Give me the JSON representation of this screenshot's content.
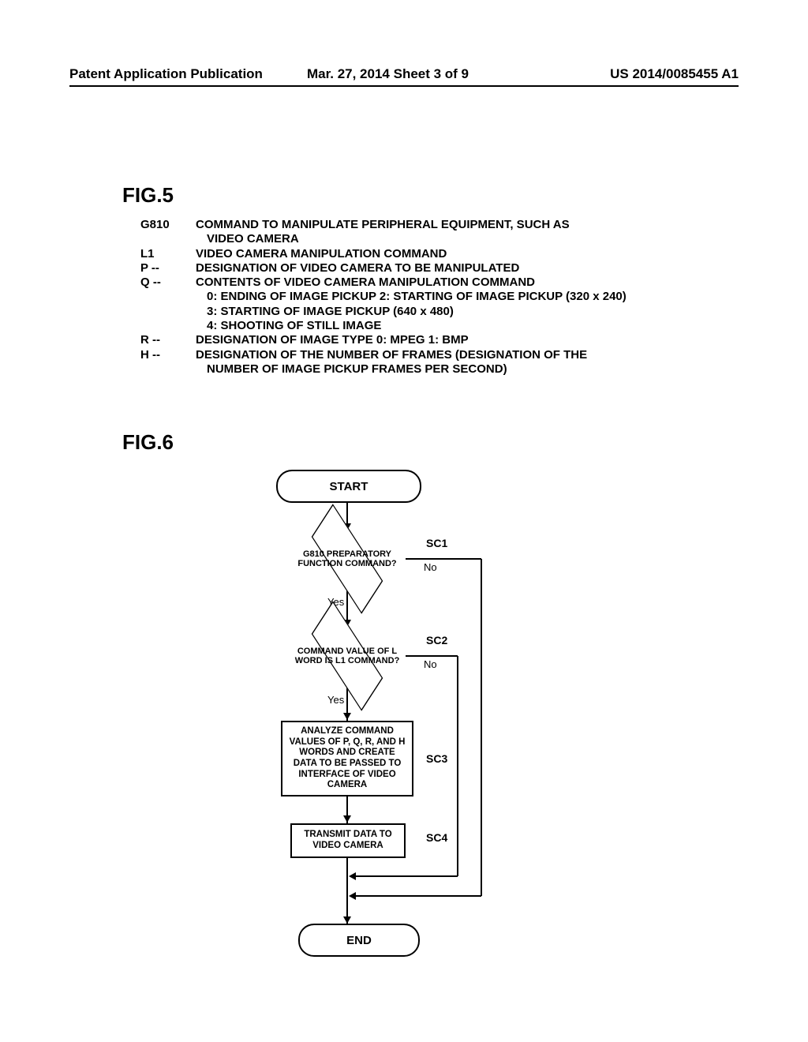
{
  "header": {
    "left": "Patent Application Publication",
    "mid": "Mar. 27, 2014  Sheet 3 of 9",
    "right": "US 2014/0085455 A1"
  },
  "fig5": {
    "label": "FIG.5",
    "rows": [
      {
        "code": "G810",
        "lines": [
          "COMMAND TO MANIPULATE PERIPHERAL EQUIPMENT, SUCH AS",
          "VIDEO CAMERA"
        ]
      },
      {
        "code": "L1",
        "lines": [
          "VIDEO CAMERA MANIPULATION COMMAND"
        ]
      },
      {
        "code": "P --",
        "lines": [
          "DESIGNATION OF VIDEO CAMERA TO BE MANIPULATED"
        ]
      },
      {
        "code": "Q --",
        "lines": [
          "CONTENTS OF VIDEO CAMERA MANIPULATION COMMAND",
          "0: ENDING OF IMAGE PICKUP  2: STARTING OF IMAGE PICKUP (320 x 240)",
          "3: STARTING OF IMAGE PICKUP (640 x 480)",
          "4: SHOOTING OF STILL IMAGE"
        ]
      },
      {
        "code": "R --",
        "lines": [
          "DESIGNATION OF IMAGE TYPE  0: MPEG  1: BMP"
        ]
      },
      {
        "code": "H --",
        "lines": [
          "DESIGNATION OF THE NUMBER OF FRAMES (DESIGNATION OF THE",
          "NUMBER OF IMAGE PICKUP FRAMES PER SECOND)"
        ]
      }
    ]
  },
  "fig6": {
    "label": "FIG.6",
    "start": "START",
    "end": "END",
    "d1": "G810 PREPARATORY FUNCTION COMMAND?",
    "d2": "COMMAND VALUE OF L WORD IS L1 COMMAND?",
    "r3": "ANALYZE COMMAND VALUES OF P, Q, R, AND H WORDS AND CREATE DATA TO BE PASSED TO INTERFACE OF VIDEO CAMERA",
    "r4": "TRANSMIT DATA TO VIDEO CAMERA",
    "sc1": "SC1",
    "sc2": "SC2",
    "sc3": "SC3",
    "sc4": "SC4",
    "yes": "Yes",
    "no": "No"
  }
}
